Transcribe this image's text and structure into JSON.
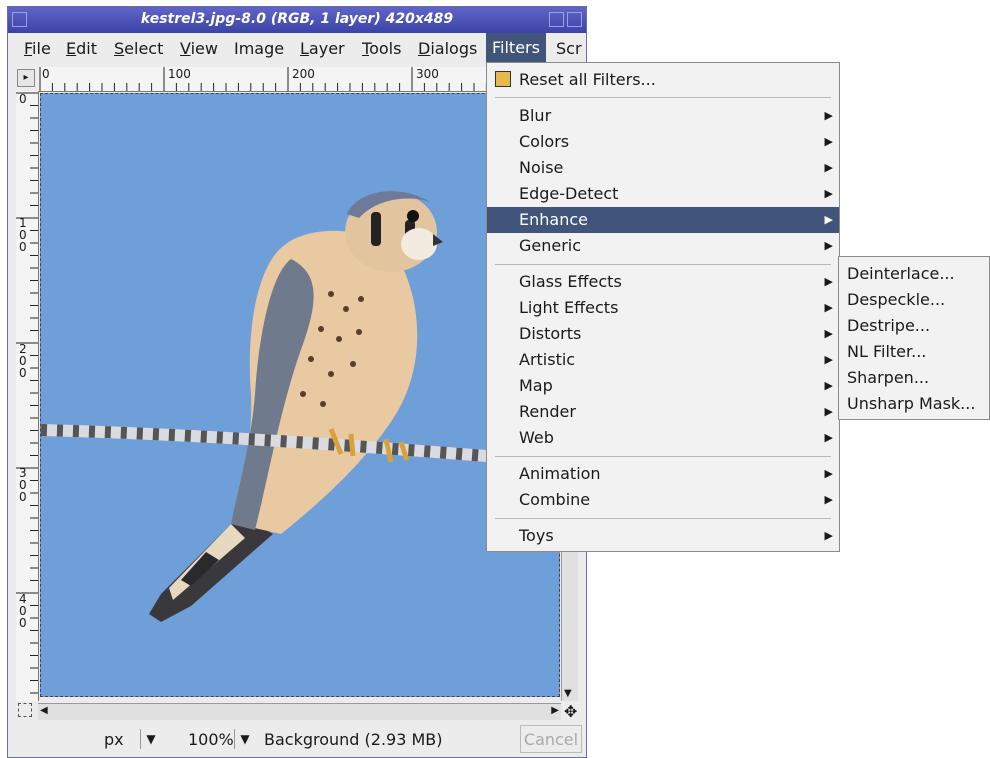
{
  "window": {
    "title": "kestrel3.jpg-8.0 (RGB, 1 layer) 420x489"
  },
  "menubar": {
    "items": [
      {
        "key": "F",
        "rest": "ile"
      },
      {
        "key": "E",
        "rest": "dit"
      },
      {
        "key": "S",
        "rest": "elect"
      },
      {
        "key": "V",
        "rest": "iew"
      },
      {
        "key": "",
        "rest": "Image"
      },
      {
        "key": "L",
        "rest": "ayer"
      },
      {
        "key": "T",
        "rest": "ools"
      },
      {
        "key": "D",
        "rest": "ialogs"
      },
      {
        "key": "",
        "rest": "Filters"
      },
      {
        "key": "",
        "rest": "Scr"
      }
    ]
  },
  "ruler": {
    "h_labels": [
      "0",
      "100",
      "200",
      "300"
    ],
    "v_labels": [
      "0",
      "1 0 0",
      "2 0 0",
      "3 0 0",
      "4 0 0"
    ]
  },
  "filters_menu": {
    "reset": "Reset all Filters...",
    "group1": [
      "Blur",
      "Colors",
      "Noise",
      "Edge-Detect",
      "Enhance",
      "Generic"
    ],
    "group2": [
      "Glass Effects",
      "Light Effects",
      "Distorts",
      "Artistic",
      "Map",
      "Render",
      "Web"
    ],
    "group3": [
      "Animation",
      "Combine"
    ],
    "group4": [
      "Toys"
    ],
    "highlighted": "Enhance"
  },
  "enhance_submenu": {
    "items": [
      "Deinterlace...",
      "Despeckle...",
      "Destripe...",
      "NL Filter...",
      "Sharpen...",
      "Unsharp Mask..."
    ]
  },
  "statusbar": {
    "unit": "px",
    "zoom": "100%",
    "status": "Background (2.93 MB)",
    "cancel": "Cancel"
  },
  "colors": {
    "menu_highlight": "#41557a",
    "sky": "#6f9fd8",
    "titlebar": "#4b52b8"
  }
}
